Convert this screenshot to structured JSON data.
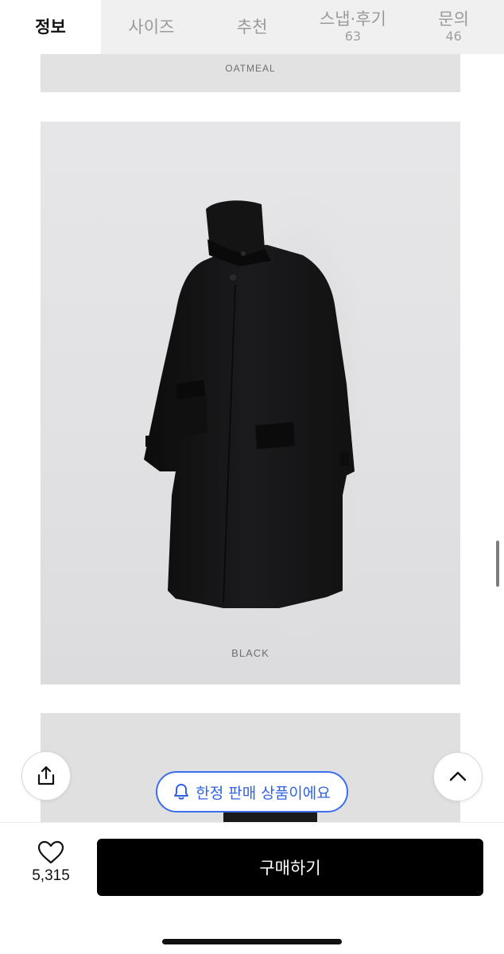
{
  "tabs": [
    {
      "label": "정보",
      "count": ""
    },
    {
      "label": "사이즈",
      "count": ""
    },
    {
      "label": "추천",
      "count": ""
    },
    {
      "label": "스냅·후기",
      "count": "63"
    },
    {
      "label": "문의",
      "count": "46"
    }
  ],
  "active_tab": "정보",
  "product_images": {
    "top_caption": "OATMEAL",
    "main_caption": "BLACK"
  },
  "banner": {
    "limited_label": "한정 판매 상품이에요",
    "icon": "bell-icon"
  },
  "floating": {
    "share_icon": "share-icon",
    "top_icon": "chevron-up-icon"
  },
  "bottom_bar": {
    "like_icon": "heart-icon",
    "like_count": "5,315",
    "buy_label": "구매하기"
  },
  "colors": {
    "accent_blue": "#2f62e6",
    "buy_button": "#000000",
    "tab_bar_bg": "#f0f0f0"
  }
}
